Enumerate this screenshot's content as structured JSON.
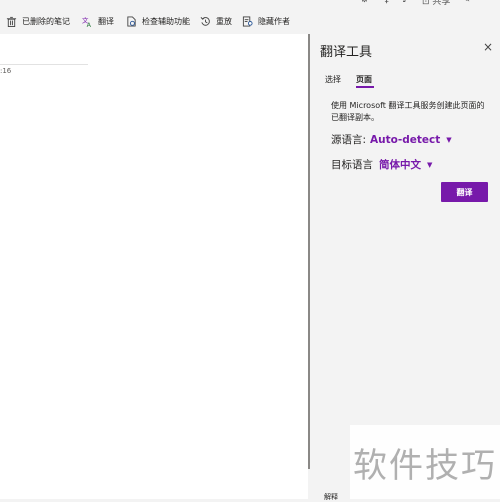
{
  "top_strip": {
    "icons": [
      "settings-icon",
      "lightbulb-icon",
      "bell-icon",
      "share-icon",
      "pen-icon"
    ],
    "partial_label": "共享"
  },
  "ribbon": {
    "items": [
      {
        "label": "已删除的笔记",
        "icon": "trash-icon"
      },
      {
        "label": "翻译",
        "icon": "translate-icon"
      },
      {
        "label": "检查辅助功能",
        "icon": "accessibility-check-icon"
      },
      {
        "label": "重放",
        "icon": "replay-icon"
      },
      {
        "label": "隐藏作者",
        "icon": "hide-authors-icon"
      }
    ]
  },
  "canvas": {
    "timestamp_fragment": ":16"
  },
  "pane": {
    "title": "翻译工具",
    "close": "×",
    "tabs": [
      {
        "label": "选择",
        "selected": false
      },
      {
        "label": "页面",
        "selected": true
      }
    ],
    "description": "使用 Microsoft 翻译工具服务创建此页面的已翻译副本。",
    "source": {
      "label": "源语言:",
      "value": "Auto-detect"
    },
    "target": {
      "label": "目标语言",
      "value": "简体中文"
    },
    "translate_button": "翻译",
    "accent_color": "#7719aa"
  },
  "bottom_fragment": "解释",
  "watermark": "软件技巧"
}
